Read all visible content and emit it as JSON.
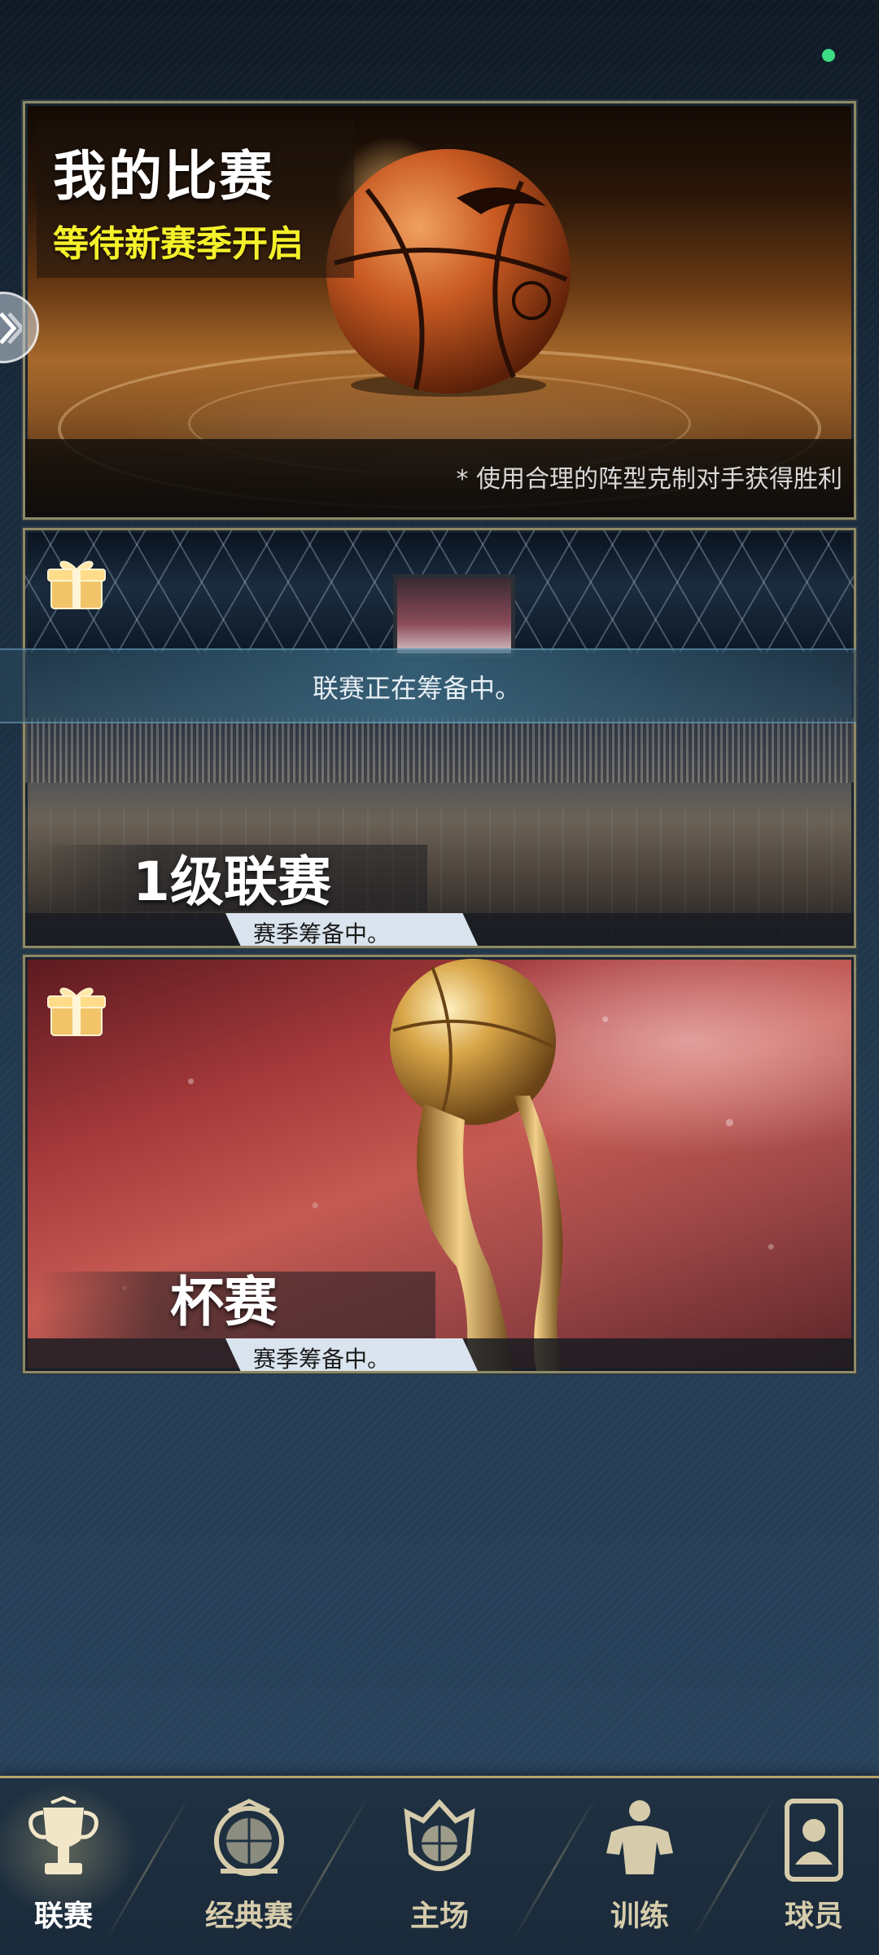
{
  "status": {
    "indicator_color": "#3ddc84"
  },
  "my_match": {
    "title": "我的比赛",
    "subtitle": "等待新赛季开启",
    "hint": "* 使用合理的阵型克制对手获得胜利"
  },
  "league": {
    "banner": "联赛正在筹备中。",
    "title": "1级联赛",
    "season_status": "赛季筹备中。"
  },
  "cup": {
    "title": "杯赛",
    "season_status": "赛季筹备中。"
  },
  "bottom_nav": {
    "items": [
      {
        "label": "联赛",
        "icon": "trophy-icon",
        "active": true
      },
      {
        "label": "经典赛",
        "icon": "classic-badge-icon",
        "active": false
      },
      {
        "label": "主场",
        "icon": "home-court-crest-icon",
        "active": false
      },
      {
        "label": "训练",
        "icon": "training-player-icon",
        "active": false
      },
      {
        "label": "球员",
        "icon": "player-card-icon",
        "active": false
      }
    ]
  },
  "colors": {
    "accent_gold": "#b8a56a",
    "subtitle_yellow": "#f5f12a",
    "background": "#22394f"
  }
}
